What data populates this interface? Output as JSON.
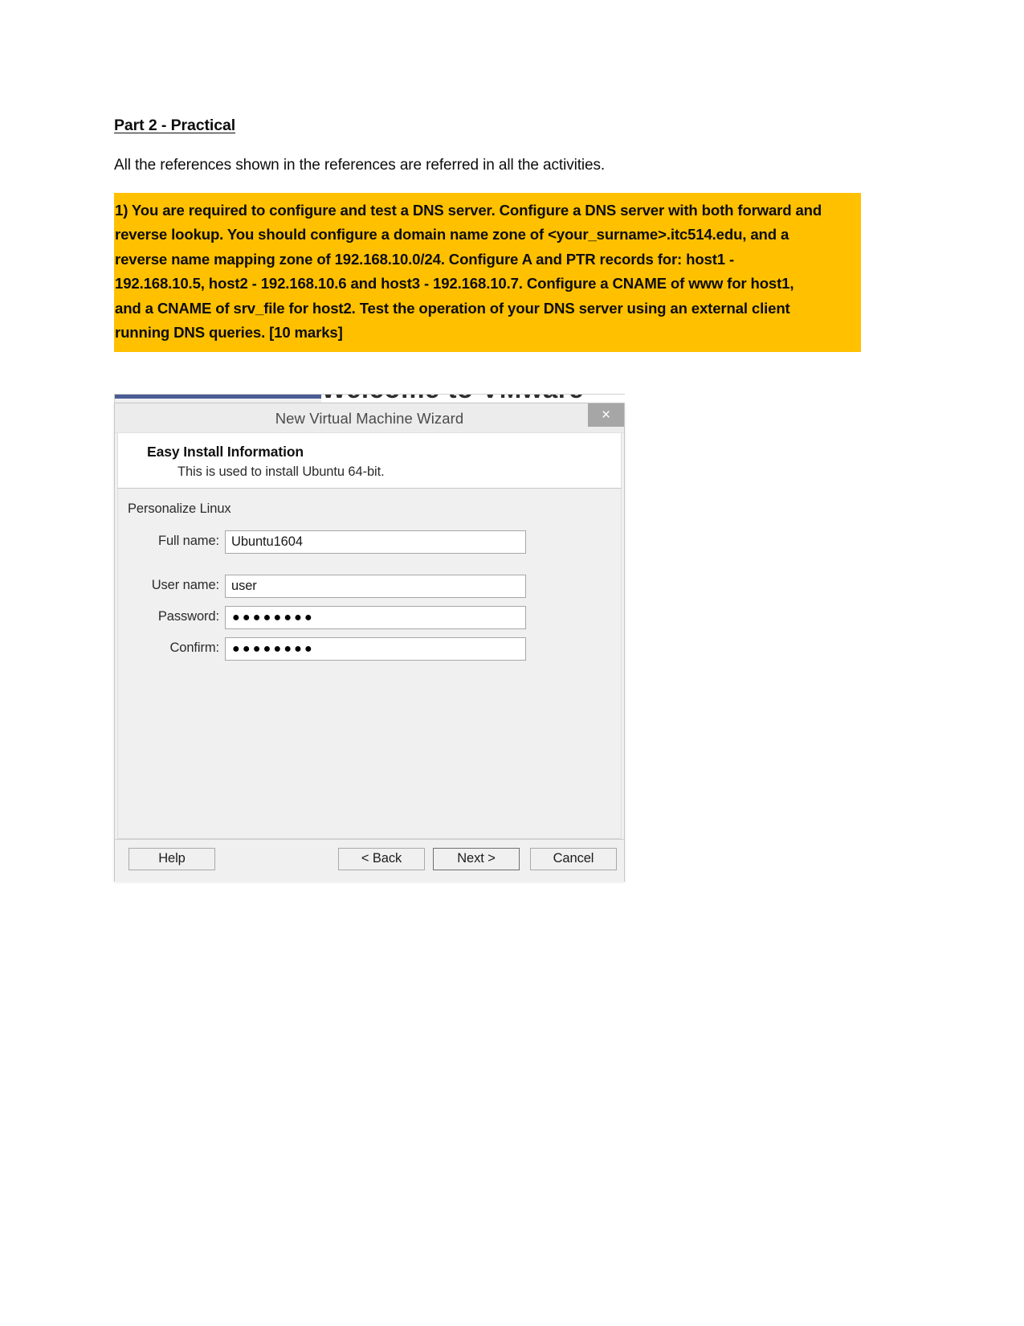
{
  "document": {
    "heading": "Part 2 - Practical",
    "intro_paragraph": "All the references shown in the references are referred in all the activities.",
    "highlight_color": "#ffc000",
    "question_lines": [
      "1) You are required to configure and test a DNS server. Configure a DNS server with both forward and",
      "reverse lookup. You should configure a domain name zone of <your_surname>.itc514.edu, and a",
      "reverse name mapping zone of 192.168.10.0/24. Configure A and PTR records for: host1 -",
      "192.168.10.5, host2 - 192.168.10.6 and host3 - 192.168.10.7. Configure a CNAME of www for host1,",
      "and a CNAME of srv_file for host2. Test the operation of your DNS server using an external client",
      "running DNS queries. [10 marks]"
    ]
  },
  "background_window": {
    "welcome_text": "Welcome to VMware",
    "accent_color": "#4a5d94"
  },
  "wizard": {
    "title": "New Virtual Machine Wizard",
    "close_label": "×",
    "header": {
      "title": "Easy Install Information",
      "subtitle": "This is used to install Ubuntu 64-bit."
    },
    "group_label": "Personalize Linux",
    "fields": [
      {
        "label": "Full name:",
        "value": "Ubuntu1604",
        "type": "text"
      },
      {
        "label": "User name:",
        "value": "user",
        "type": "text"
      },
      {
        "label": "Password:",
        "value": "●●●●●●●●",
        "type": "password"
      },
      {
        "label": "Confirm:",
        "value": "●●●●●●●●",
        "type": "password"
      }
    ],
    "buttons": {
      "help": "Help",
      "back": "< Back",
      "next": "Next >",
      "cancel": "Cancel"
    }
  }
}
